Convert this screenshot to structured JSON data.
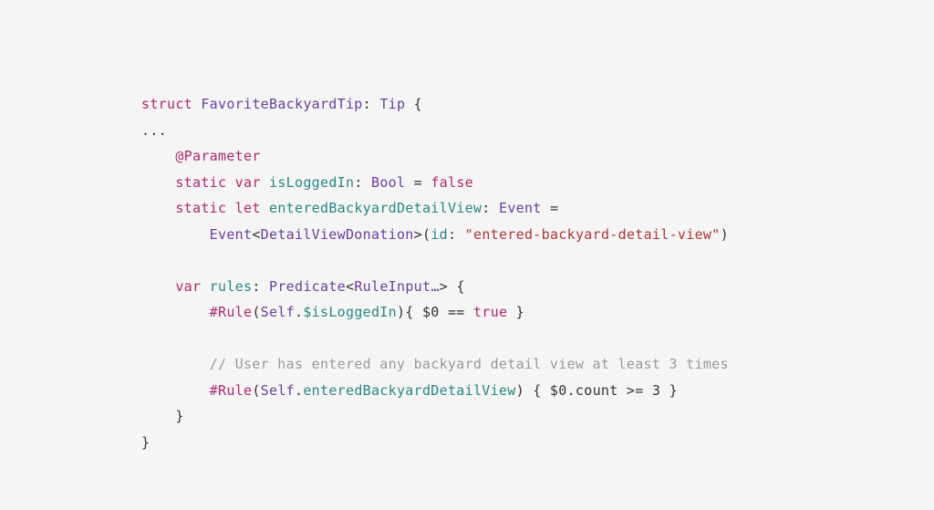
{
  "code": {
    "line1": {
      "kw1": "struct",
      "type1": "FavoriteBackyardTip",
      "colon": ":",
      "type2": "Tip",
      "brace": " {"
    },
    "line2": {
      "text": "..."
    },
    "line3": {
      "indent": "    ",
      "attr": "@Parameter"
    },
    "line4": {
      "indent": "    ",
      "kw1": "static",
      "kw2": "var",
      "name": "isLoggedIn",
      "colon": ":",
      "type": "Bool",
      "eq": " = ",
      "val": "false"
    },
    "line5": {
      "indent": "    ",
      "kw1": "static",
      "kw2": "let",
      "name": "enteredBackyardDetailView",
      "colon": ":",
      "type": "Event",
      "eq": " ="
    },
    "line6": {
      "indent": "        ",
      "type1": "Event",
      "lt": "<",
      "type2": "DetailViewDonation",
      "gt": ">(",
      "arg": "id",
      "colon": ":",
      "str": "\"entered-backyard-detail-view\"",
      "close": ")"
    },
    "line7": {
      "text": ""
    },
    "line8": {
      "indent": "    ",
      "kw": "var",
      "name": "rules",
      "colon": ":",
      "type1": "Predicate",
      "lt": "<",
      "type2": "RuleInput…",
      "gt": ">",
      "brace": " {"
    },
    "line9": {
      "indent": "        ",
      "rule": "#Rule",
      "open": "(",
      "type": "Self",
      "dot": ".",
      "prop": "$isLoggedIn",
      "close": "){ $0 == ",
      "val": "true",
      "close2": " }"
    },
    "line10": {
      "text": ""
    },
    "line11": {
      "indent": "        ",
      "comment": "// User has entered any backyard detail view at least 3 times"
    },
    "line12": {
      "indent": "        ",
      "rule": "#Rule",
      "open": "(",
      "type": "Self",
      "dot": ".",
      "prop": "enteredBackyardDetailView",
      "close": ") { $0.count >= ",
      "num": "3",
      "close2": " }"
    },
    "line13": {
      "indent": "    ",
      "brace": "}"
    },
    "line14": {
      "brace": "}"
    }
  }
}
